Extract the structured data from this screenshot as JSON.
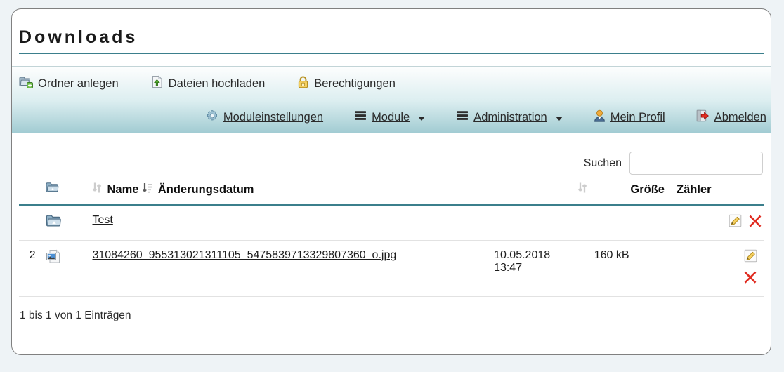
{
  "page": {
    "title": "Downloads",
    "accent_color": "#3b7f8c",
    "background_color": "#eef3f6"
  },
  "toolbar": {
    "primary_actions": [
      {
        "label": "Ordner anlegen",
        "icon": "folder-add-icon"
      },
      {
        "label": "Dateien hochladen",
        "icon": "file-upload-icon"
      },
      {
        "label": "Berechtigungen",
        "icon": "lock-icon"
      }
    ],
    "menu_actions": [
      {
        "label": "Moduleinstellungen",
        "icon": "gear-icon",
        "has_caret": false
      },
      {
        "label": "Module",
        "icon": "hamburger-icon",
        "has_caret": true
      },
      {
        "label": "Administration",
        "icon": "hamburger-icon",
        "has_caret": true
      },
      {
        "label": "Mein Profil",
        "icon": "user-icon",
        "has_caret": false
      },
      {
        "label": "Abmelden",
        "icon": "logout-icon",
        "has_caret": false
      }
    ]
  },
  "search": {
    "label": "Suchen",
    "value": "",
    "placeholder": ""
  },
  "table": {
    "columns": [
      {
        "label": "",
        "icon": "folder-icon",
        "sort": "none"
      },
      {
        "label": "Name",
        "sort": "both"
      },
      {
        "label": "Änderungsdatum",
        "sort": "desc"
      },
      {
        "label": "",
        "sort": "both"
      },
      {
        "label": "Größe",
        "sort": "both"
      },
      {
        "label": "Zähler",
        "sort": "both"
      }
    ],
    "rows": [
      {
        "counter": "",
        "type_icon": "folder-icon",
        "name": "Test",
        "modified": "",
        "size": "",
        "actions": [
          "edit-icon",
          "delete-icon"
        ],
        "actions_layout": "inline"
      },
      {
        "counter": "2",
        "type_icon": "image-file-icon",
        "name": "31084260_955313021311105_5475839713329807360_o.jpg",
        "modified": "10.05.2018 13:47",
        "modified_date": "10.05.2018",
        "modified_time": "13:47",
        "size": "160 kB",
        "actions": [
          "edit-icon",
          "delete-icon"
        ],
        "actions_layout": "stacked"
      }
    ],
    "footer_info": "1 bis 1 von 1 Einträgen"
  }
}
